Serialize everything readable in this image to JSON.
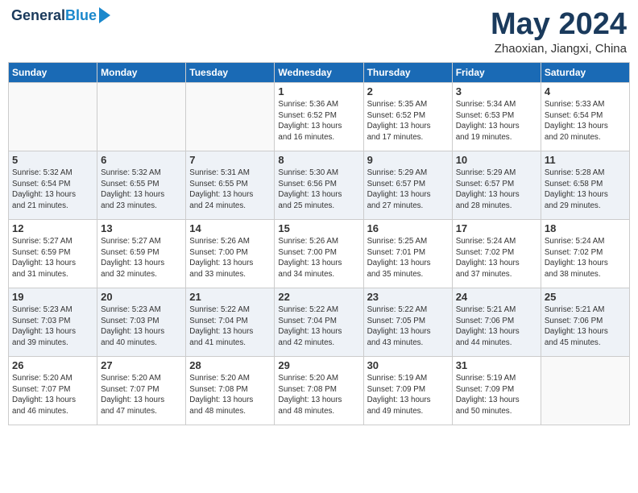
{
  "header": {
    "logo_line1": "General",
    "logo_line2": "Blue",
    "month_title": "May 2024",
    "location": "Zhaoxian, Jiangxi, China"
  },
  "days_of_week": [
    "Sunday",
    "Monday",
    "Tuesday",
    "Wednesday",
    "Thursday",
    "Friday",
    "Saturday"
  ],
  "weeks": [
    {
      "days": [
        {
          "number": "",
          "info": ""
        },
        {
          "number": "",
          "info": ""
        },
        {
          "number": "",
          "info": ""
        },
        {
          "number": "1",
          "info": "Sunrise: 5:36 AM\nSunset: 6:52 PM\nDaylight: 13 hours\nand 16 minutes."
        },
        {
          "number": "2",
          "info": "Sunrise: 5:35 AM\nSunset: 6:52 PM\nDaylight: 13 hours\nand 17 minutes."
        },
        {
          "number": "3",
          "info": "Sunrise: 5:34 AM\nSunset: 6:53 PM\nDaylight: 13 hours\nand 19 minutes."
        },
        {
          "number": "4",
          "info": "Sunrise: 5:33 AM\nSunset: 6:54 PM\nDaylight: 13 hours\nand 20 minutes."
        }
      ]
    },
    {
      "days": [
        {
          "number": "5",
          "info": "Sunrise: 5:32 AM\nSunset: 6:54 PM\nDaylight: 13 hours\nand 21 minutes."
        },
        {
          "number": "6",
          "info": "Sunrise: 5:32 AM\nSunset: 6:55 PM\nDaylight: 13 hours\nand 23 minutes."
        },
        {
          "number": "7",
          "info": "Sunrise: 5:31 AM\nSunset: 6:55 PM\nDaylight: 13 hours\nand 24 minutes."
        },
        {
          "number": "8",
          "info": "Sunrise: 5:30 AM\nSunset: 6:56 PM\nDaylight: 13 hours\nand 25 minutes."
        },
        {
          "number": "9",
          "info": "Sunrise: 5:29 AM\nSunset: 6:57 PM\nDaylight: 13 hours\nand 27 minutes."
        },
        {
          "number": "10",
          "info": "Sunrise: 5:29 AM\nSunset: 6:57 PM\nDaylight: 13 hours\nand 28 minutes."
        },
        {
          "number": "11",
          "info": "Sunrise: 5:28 AM\nSunset: 6:58 PM\nDaylight: 13 hours\nand 29 minutes."
        }
      ]
    },
    {
      "days": [
        {
          "number": "12",
          "info": "Sunrise: 5:27 AM\nSunset: 6:59 PM\nDaylight: 13 hours\nand 31 minutes."
        },
        {
          "number": "13",
          "info": "Sunrise: 5:27 AM\nSunset: 6:59 PM\nDaylight: 13 hours\nand 32 minutes."
        },
        {
          "number": "14",
          "info": "Sunrise: 5:26 AM\nSunset: 7:00 PM\nDaylight: 13 hours\nand 33 minutes."
        },
        {
          "number": "15",
          "info": "Sunrise: 5:26 AM\nSunset: 7:00 PM\nDaylight: 13 hours\nand 34 minutes."
        },
        {
          "number": "16",
          "info": "Sunrise: 5:25 AM\nSunset: 7:01 PM\nDaylight: 13 hours\nand 35 minutes."
        },
        {
          "number": "17",
          "info": "Sunrise: 5:24 AM\nSunset: 7:02 PM\nDaylight: 13 hours\nand 37 minutes."
        },
        {
          "number": "18",
          "info": "Sunrise: 5:24 AM\nSunset: 7:02 PM\nDaylight: 13 hours\nand 38 minutes."
        }
      ]
    },
    {
      "days": [
        {
          "number": "19",
          "info": "Sunrise: 5:23 AM\nSunset: 7:03 PM\nDaylight: 13 hours\nand 39 minutes."
        },
        {
          "number": "20",
          "info": "Sunrise: 5:23 AM\nSunset: 7:03 PM\nDaylight: 13 hours\nand 40 minutes."
        },
        {
          "number": "21",
          "info": "Sunrise: 5:22 AM\nSunset: 7:04 PM\nDaylight: 13 hours\nand 41 minutes."
        },
        {
          "number": "22",
          "info": "Sunrise: 5:22 AM\nSunset: 7:04 PM\nDaylight: 13 hours\nand 42 minutes."
        },
        {
          "number": "23",
          "info": "Sunrise: 5:22 AM\nSunset: 7:05 PM\nDaylight: 13 hours\nand 43 minutes."
        },
        {
          "number": "24",
          "info": "Sunrise: 5:21 AM\nSunset: 7:06 PM\nDaylight: 13 hours\nand 44 minutes."
        },
        {
          "number": "25",
          "info": "Sunrise: 5:21 AM\nSunset: 7:06 PM\nDaylight: 13 hours\nand 45 minutes."
        }
      ]
    },
    {
      "days": [
        {
          "number": "26",
          "info": "Sunrise: 5:20 AM\nSunset: 7:07 PM\nDaylight: 13 hours\nand 46 minutes."
        },
        {
          "number": "27",
          "info": "Sunrise: 5:20 AM\nSunset: 7:07 PM\nDaylight: 13 hours\nand 47 minutes."
        },
        {
          "number": "28",
          "info": "Sunrise: 5:20 AM\nSunset: 7:08 PM\nDaylight: 13 hours\nand 48 minutes."
        },
        {
          "number": "29",
          "info": "Sunrise: 5:20 AM\nSunset: 7:08 PM\nDaylight: 13 hours\nand 48 minutes."
        },
        {
          "number": "30",
          "info": "Sunrise: 5:19 AM\nSunset: 7:09 PM\nDaylight: 13 hours\nand 49 minutes."
        },
        {
          "number": "31",
          "info": "Sunrise: 5:19 AM\nSunset: 7:09 PM\nDaylight: 13 hours\nand 50 minutes."
        },
        {
          "number": "",
          "info": ""
        }
      ]
    }
  ]
}
